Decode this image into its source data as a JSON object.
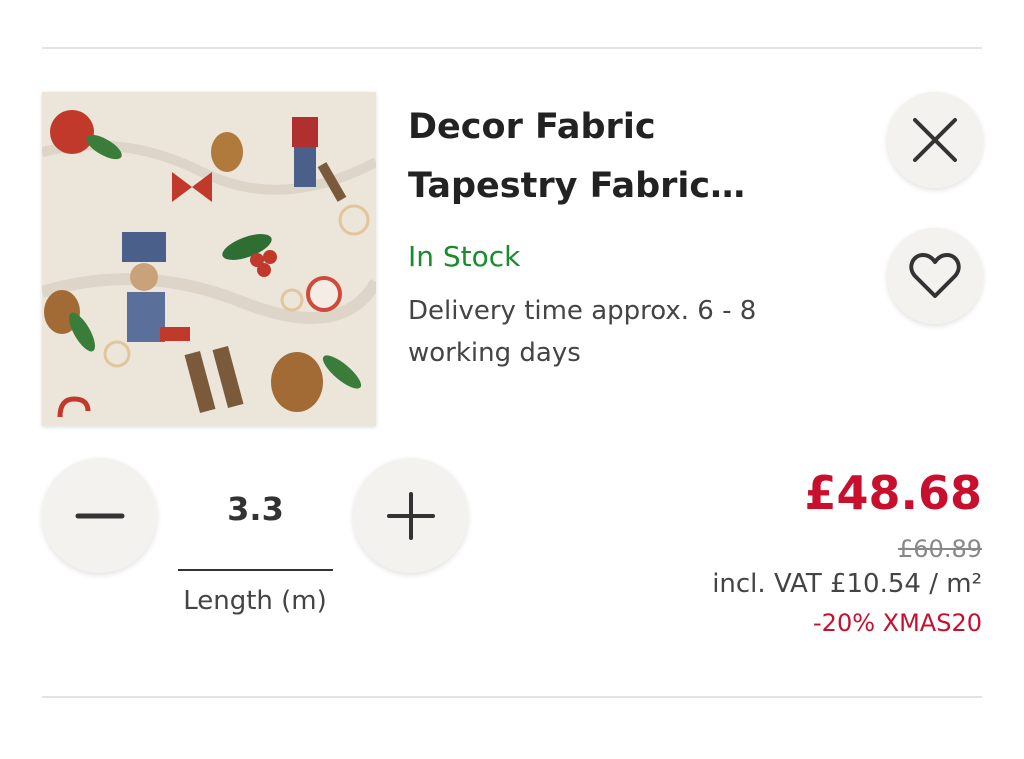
{
  "product": {
    "title_line1": "Decor Fabric",
    "title_line2": "Tapestry Fabric…",
    "stock_status": "In Stock",
    "delivery_text": "Delivery time approx. 6 - 8 working days",
    "image_icon": "nutcracker-christmas-fabric-image"
  },
  "actions": {
    "close_icon": "close-icon",
    "wishlist_icon": "heart-icon"
  },
  "quantity": {
    "value": "3.3",
    "label": "Length (m)",
    "decrease_icon": "minus-icon",
    "increase_icon": "plus-icon"
  },
  "pricing": {
    "current_price": "£48.68",
    "original_price": "£60.89",
    "vat_text": "incl. VAT £10.54 / m²",
    "promo_text": "-20% XMAS20"
  },
  "colors": {
    "price_red": "#c8102e",
    "stock_green": "#1a8c2d",
    "button_bg": "#f4f2ef"
  }
}
